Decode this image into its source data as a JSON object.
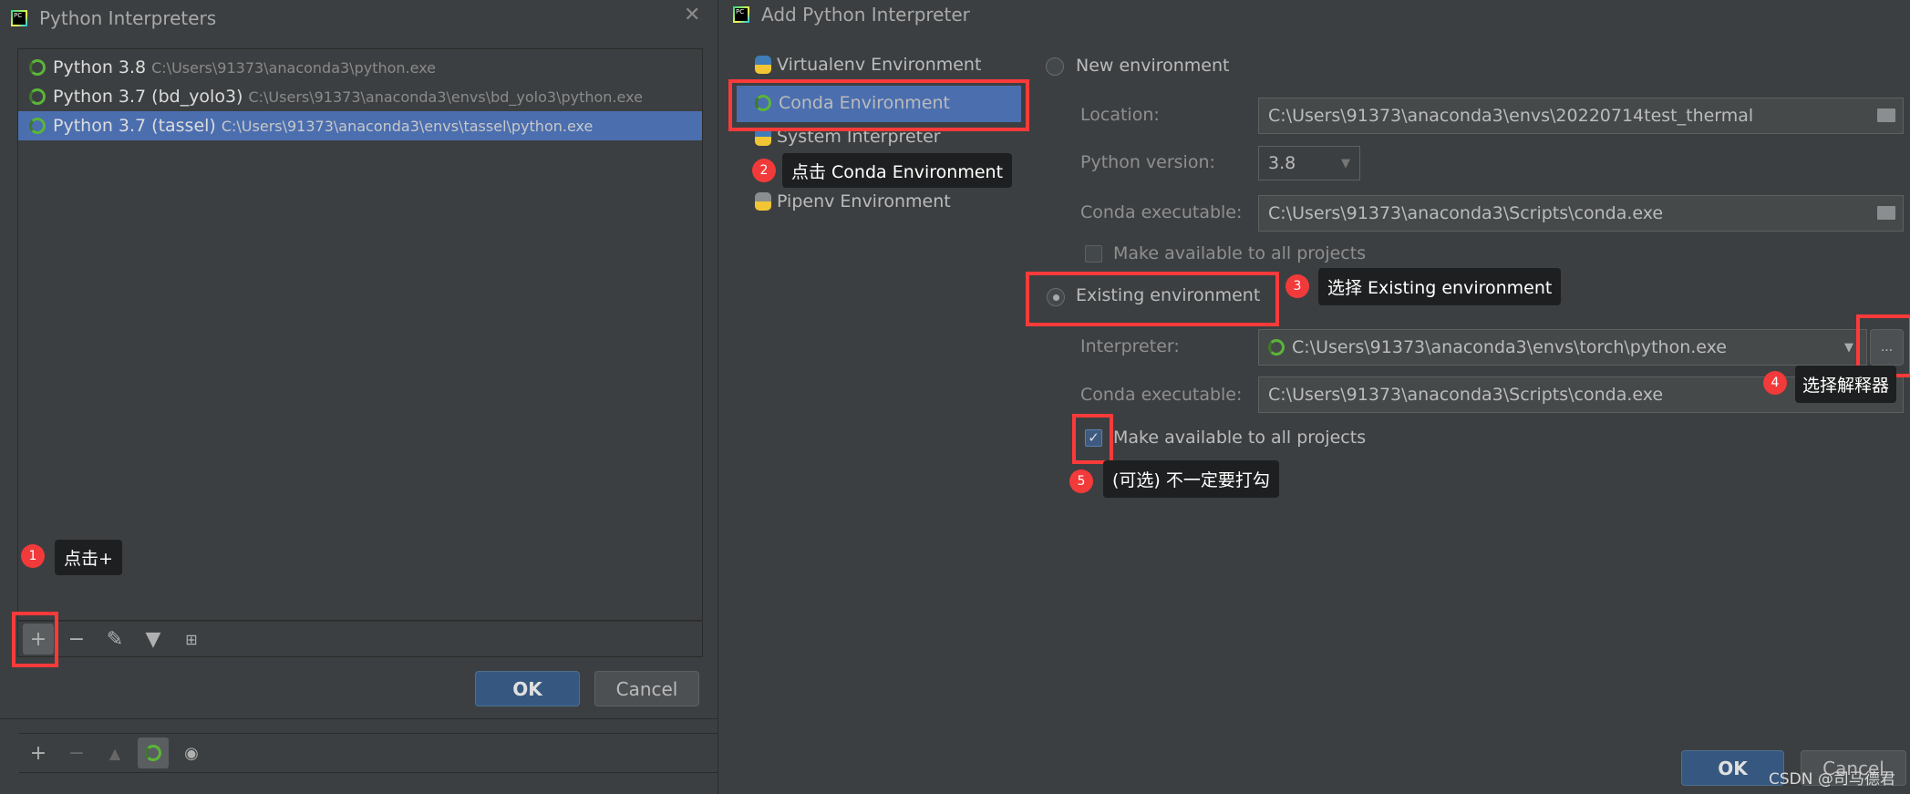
{
  "left_dialog": {
    "title": "Python Interpreters",
    "interpreters": [
      {
        "name": "Python 3.8",
        "path": "C:\\Users\\91373\\anaconda3\\python.exe",
        "selected": false
      },
      {
        "name": "Python 3.7 (bd_yolo3)",
        "path": "C:\\Users\\91373\\anaconda3\\envs\\bd_yolo3\\python.exe",
        "selected": false
      },
      {
        "name": "Python 3.7 (tassel)",
        "path": "C:\\Users\\91373\\anaconda3\\envs\\tassel\\python.exe",
        "selected": true
      }
    ],
    "toolbar_icons": [
      "plus-icon",
      "minus-icon",
      "pencil-icon",
      "filter-icon",
      "tree-icon"
    ],
    "ok_label": "OK",
    "cancel_label": "Cancel",
    "bottom_toolbar_icons": [
      "plus-icon",
      "minus-icon",
      "up-icon",
      "conda-icon",
      "eye-icon"
    ]
  },
  "right_dialog": {
    "title": "Add Python Interpreter",
    "nav": [
      {
        "label": "Virtualenv Environment",
        "icon": "python-icon",
        "selected": false
      },
      {
        "label": "Conda Environment",
        "icon": "conda-icon",
        "selected": true
      },
      {
        "label": "System Interpreter",
        "icon": "python-icon",
        "selected": false
      },
      {
        "label": "Pipenv Environment",
        "icon": "pipenv-icon",
        "selected": false
      }
    ],
    "new_env": {
      "label": "New environment",
      "selected": false,
      "location_label": "Location:",
      "location_value": "C:\\Users\\91373\\anaconda3\\envs\\20220714test_thermal",
      "python_version_label": "Python version:",
      "python_version_value": "3.8",
      "conda_exec_label": "Conda executable:",
      "conda_exec_value": "C:\\Users\\91373\\anaconda3\\Scripts\\conda.exe",
      "make_available_label": "Make available to all projects",
      "make_available_checked": false
    },
    "existing_env": {
      "label": "Existing environment",
      "selected": true,
      "interpreter_label": "Interpreter:",
      "interpreter_value": "C:\\Users\\91373\\anaconda3\\envs\\torch\\python.exe",
      "browse_label": "...",
      "conda_exec_label": "Conda executable:",
      "conda_exec_value": "C:\\Users\\91373\\anaconda3\\Scripts\\conda.exe",
      "make_available_label": "Make available to all projects",
      "make_available_checked": true
    },
    "ok_label": "OK",
    "cancel_label": "Cancel"
  },
  "annotations": [
    {
      "num": "1",
      "text": "点击+"
    },
    {
      "num": "2",
      "text": "点击 Conda Environment"
    },
    {
      "num": "3",
      "text": "选择 Existing environment"
    },
    {
      "num": "4",
      "text": "选择解释器"
    },
    {
      "num": "5",
      "text": "(可选) 不一定要打勾"
    }
  ],
  "colors": {
    "background": "#3c3f41",
    "selection": "#4b6eaf",
    "annotation_red": "#fd3a3a",
    "ok_button": "#365880"
  },
  "watermark": "CSDN @司马德君"
}
